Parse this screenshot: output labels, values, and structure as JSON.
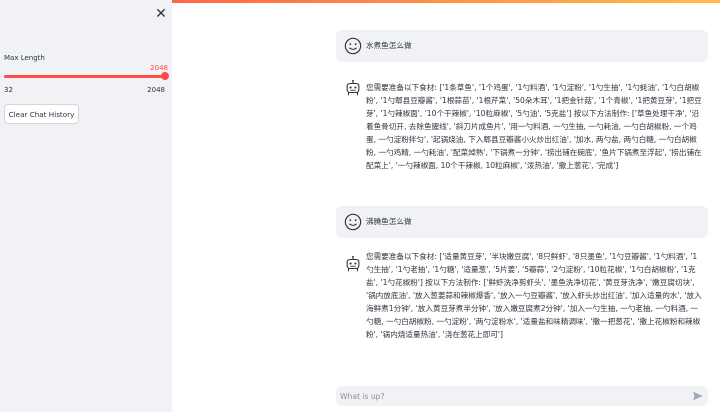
{
  "sidebar": {
    "close_icon": "close-icon",
    "max_length_label": "Max Length",
    "max_length_value": "2048",
    "slider_min": "32",
    "slider_max": "2048",
    "slider_fraction": 1.0,
    "clear_button": "Clear Chat History"
  },
  "messages": [
    {
      "role": "user",
      "avatar": "smiley-face-icon",
      "text": "水煮鱼怎么做"
    },
    {
      "role": "assistant",
      "avatar": "robot-icon",
      "text": "您需要准备以下食材: ['1条草鱼', '1个鸡蛋', '1勺料酒', '1勺淀粉', '1勺生抽', '1勺蚝油', '1勺白胡椒粉', '1勺郫县豆瓣酱', '1根蒜苗', '1根芹菜', '50朵木耳', '1把金针菇', '1个青椒', '1把黄豆芽', '1把豆芽', '1勺辣椒面', '10个干辣椒', '10粒麻椒', '5勺油', '5克盐'] 按以下方法制作: ['草鱼处理干净', '沿着鱼骨切开, 去除鱼腥线', '斜刀片成鱼片', '用一勺料酒, 一勺生抽, 一勺耗油, 一勺白胡椒粉, 一个鸡蛋, 一勺淀粉拌匀', '起锅烧油, 下入郫县豆瓣酱小火炒出红油', '加水, 两勺盐, 两勺白糖, 一勺白胡椒粉, 一勺鸡精, 一勺耗油', '配菜焯熟', '下锅煮一分钟', '捞出铺在碗底', '鱼片下锅煮至浮起', '捞出铺在配菜上', '一勺辣椒面, 10个干辣椒, 10粒麻椒', '泼热油', '撒上葱花', '完成']"
    },
    {
      "role": "user",
      "avatar": "smiley-face-icon",
      "text": "沸腾鱼怎么做"
    },
    {
      "role": "assistant",
      "avatar": "robot-icon",
      "text": "您需要准备以下食材: ['适量黄豆芽', '半块嫩豆腐', '8只鲜虾', '8只墨鱼', '1勺豆瓣酱', '1勺料酒', '1勺生抽', '1勺老抽', '1勺糖', '适量葱', '5片姜', '5瓣蒜', '2勺淀粉', '10粒花椒', '1勺白胡椒粉', '1克盐', '1勺花椒粉'] 按以下方法制作: ['鲜虾洗净剪虾头', '墨鱼洗净切花', '黄豆芽洗净', '嫩豆腐切块', '锅内放底油', '放入葱姜蒜和辣椒爆香', '放入一勺豆瓣酱', '放入虾头炒出红油', '加入适量的水', '放入海鲜煮1分钟', '放入黄豆芽煮半分钟', '放入嫩豆腐煮2分钟', '加入一勺生抽, 一勺老抽, 一勺料酒, 一勺糖, 一勺白胡椒粉, 一勺淀粉', '两勺淀粉水', '适量盐和味精调味', '撒一把葱花', '撒上花椒粉和辣椒粉', '锅内烧适量热油', '浇在葱花上即可']"
    }
  ],
  "chat_input": {
    "placeholder": "What is up?",
    "send_icon": "send-icon"
  },
  "colors": {
    "accent": "#ff4b4b",
    "sidebar_bg": "#f0f2f6",
    "text": "#31333f"
  }
}
